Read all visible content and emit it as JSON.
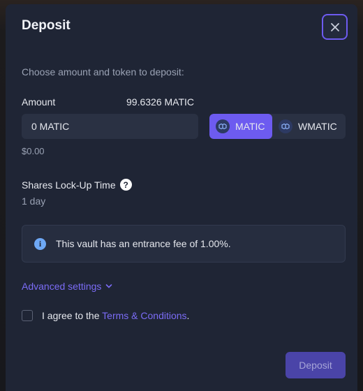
{
  "modal": {
    "title": "Deposit",
    "subtitle": "Choose amount and token to deposit:"
  },
  "amount": {
    "label": "Amount",
    "balance": "99.6326 MATIC",
    "input_value": "0 MATIC",
    "usd_value": "$0.00"
  },
  "tokens": [
    {
      "label": "MATIC",
      "selected": true
    },
    {
      "label": "WMATIC",
      "selected": false
    }
  ],
  "lockup": {
    "label": "Shares Lock-Up Time",
    "value": "1 day",
    "help_glyph": "?"
  },
  "info": {
    "icon_glyph": "i",
    "text": "This vault has an entrance fee of 1.00%."
  },
  "advanced": {
    "label": "Advanced settings"
  },
  "agreement": {
    "prefix": "I agree to the",
    "link": "Terms & Conditions",
    "suffix": ".",
    "checked": false
  },
  "actions": {
    "deposit_label": "Deposit"
  },
  "icons": {
    "close": "close-icon",
    "token": "polygon-token-icon",
    "help": "question-circle-icon",
    "info": "info-circle-icon",
    "chevron": "chevron-down-icon"
  },
  "colors": {
    "modal_bg": "#1f2535",
    "accent": "#6d5bf0",
    "link": "#7b6cf6",
    "info_icon": "#6ea8f5",
    "deposit_disabled": "#4a44a8"
  }
}
